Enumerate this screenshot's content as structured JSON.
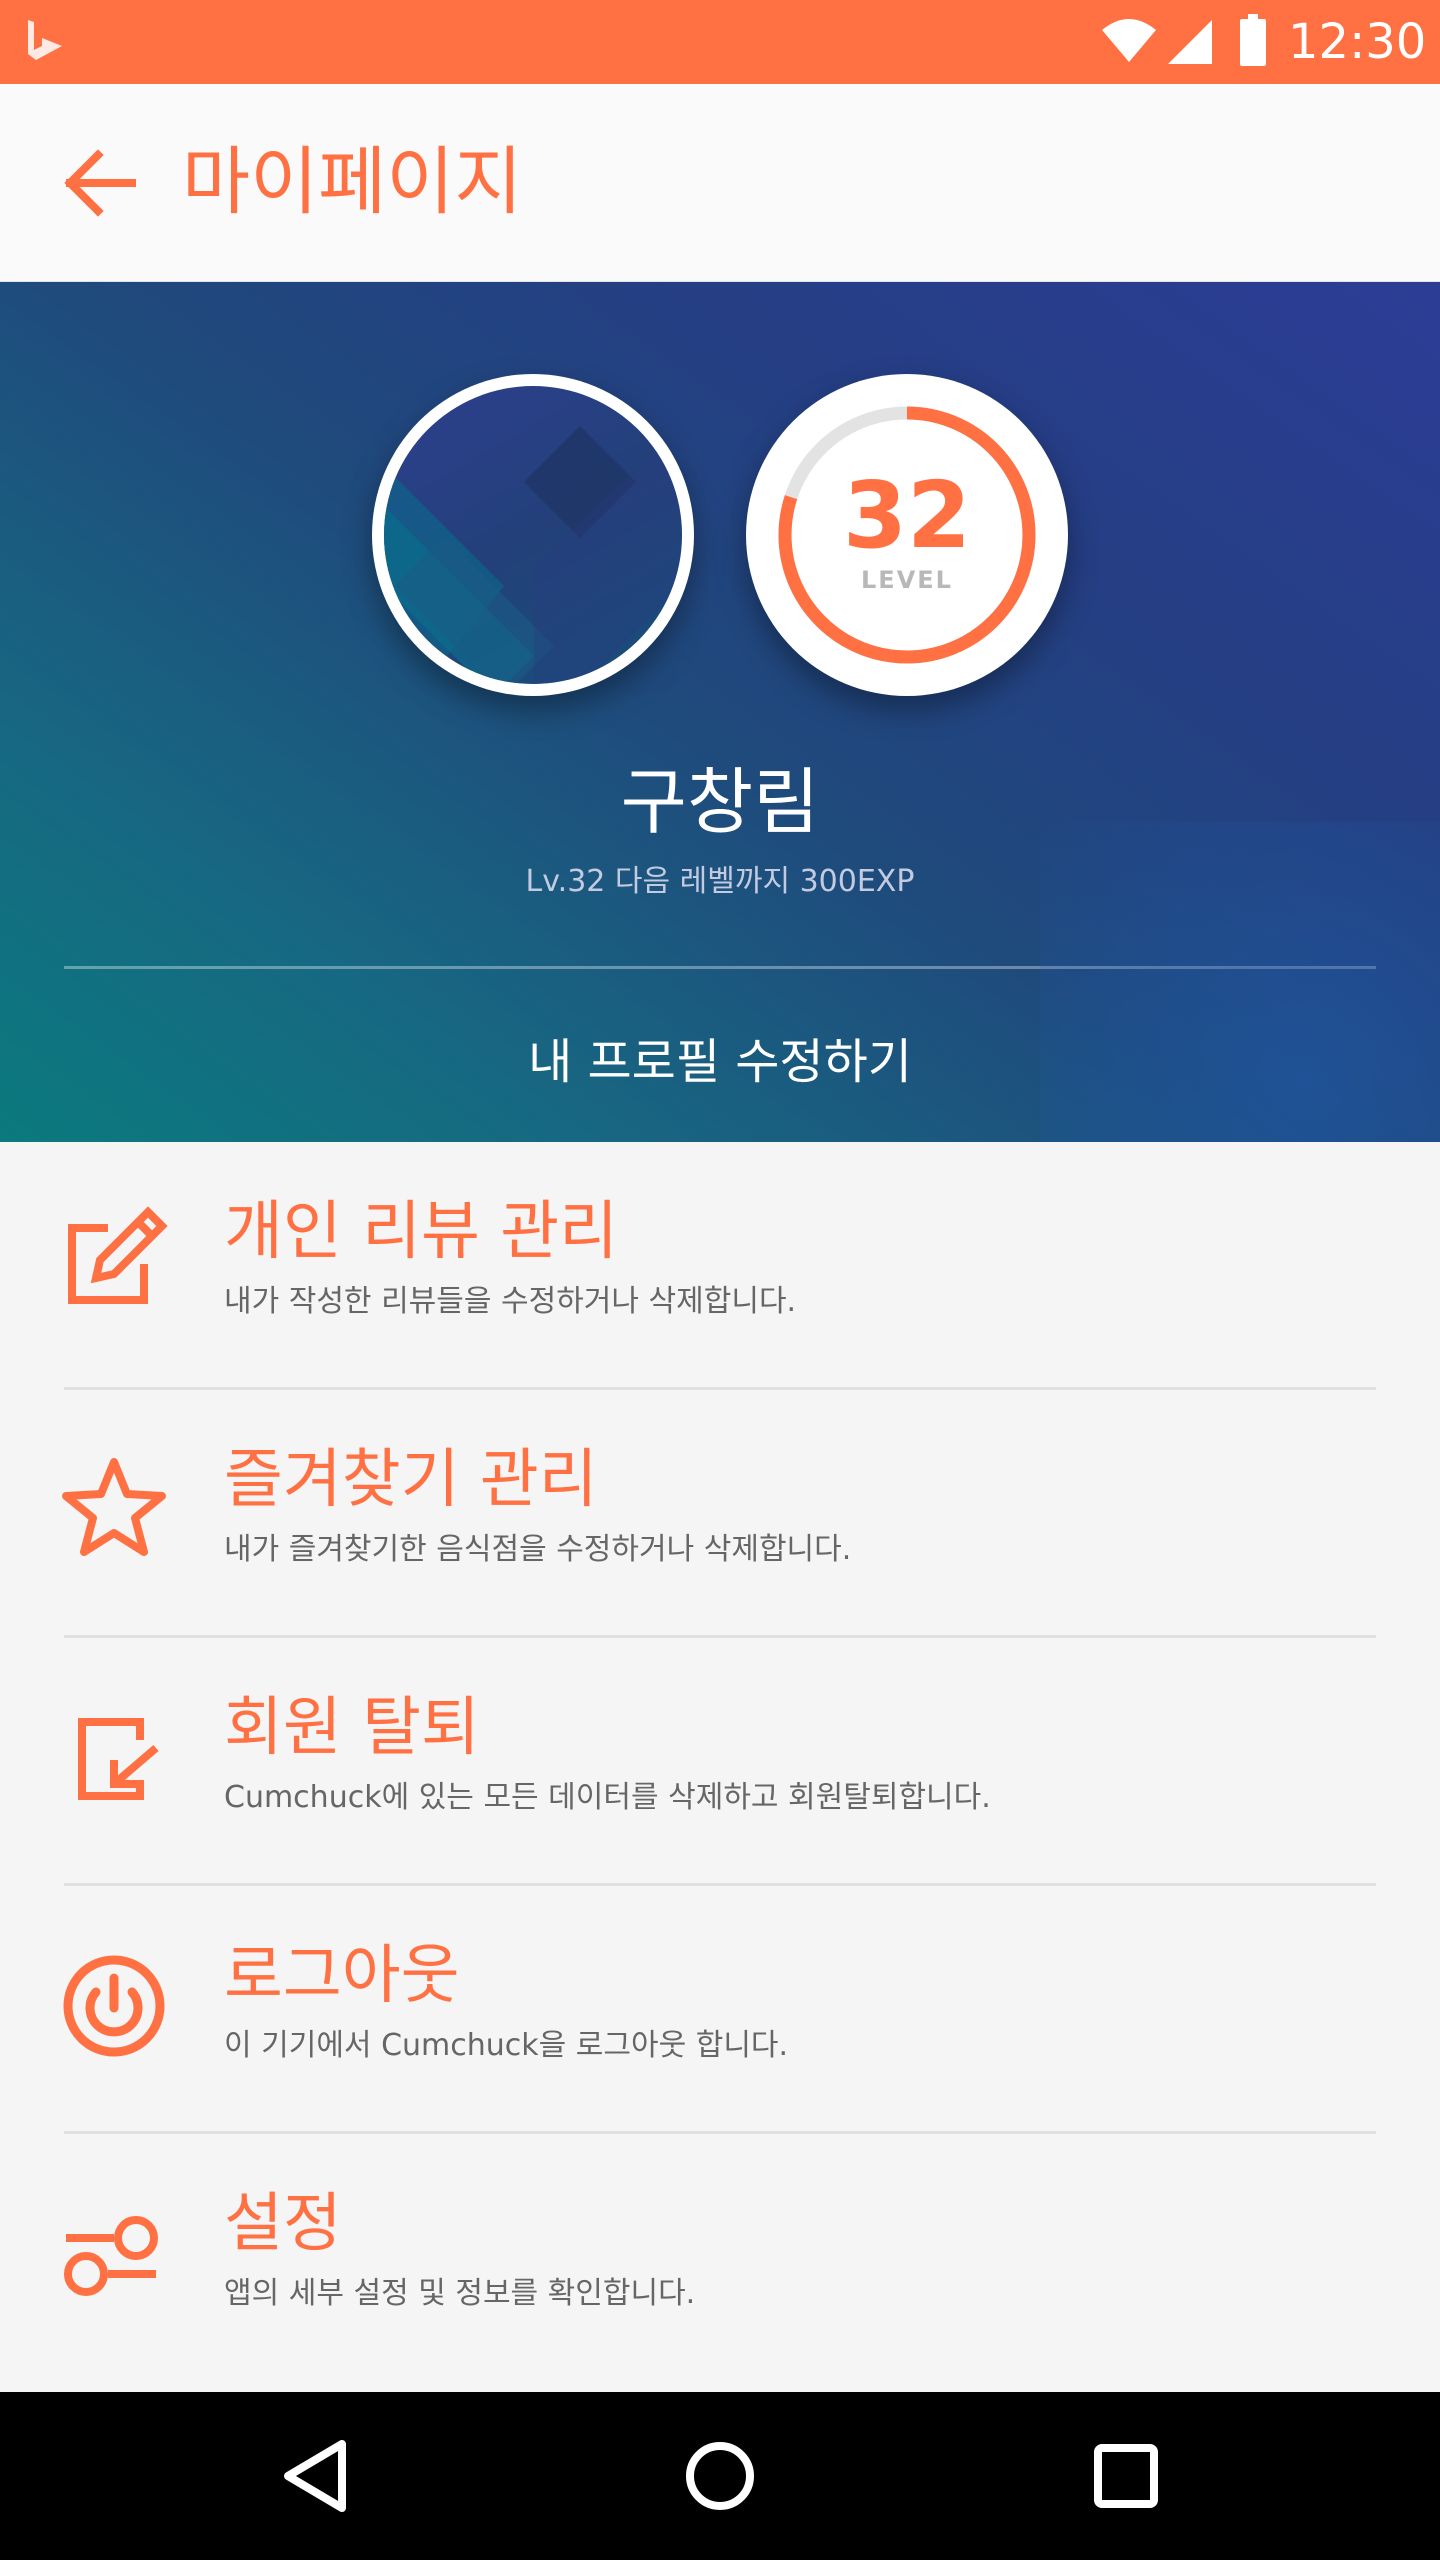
{
  "status_bar": {
    "time": "12:30",
    "icons": [
      "app-logo-icon",
      "wifi-icon",
      "signal-icon",
      "battery-icon"
    ],
    "color": "#ff7043"
  },
  "app_bar": {
    "title": "마이페이지",
    "back_icon": "arrow-back-icon"
  },
  "profile": {
    "name": "구창림",
    "level": "32",
    "level_label": "LEVEL",
    "level_progress": 0.8,
    "subtitle": "Lv.32 다음 레벨까지 300EXP",
    "edit_label": "내 프로필 수정하기"
  },
  "menu": [
    {
      "title": "개인 리뷰 관리",
      "description": "내가 작성한 리뷰들을 수정하거나 삭제합니다.",
      "icon": "edit-icon"
    },
    {
      "title": "즐겨찾기 관리",
      "description": "내가 즐겨찾기한 음식점을 수정하거나 삭제합니다.",
      "icon": "star-icon"
    },
    {
      "title": "회원 탈퇴",
      "description": "Cumchuck에 있는 모든 데이터를 삭제하고 회원탈퇴합니다.",
      "icon": "exit-icon"
    },
    {
      "title": "로그아웃",
      "description": "이 기기에서 Cumchuck을 로그아웃 합니다.",
      "icon": "power-icon"
    },
    {
      "title": "설정",
      "description": "앱의 세부 설정 및 정보를 확인합니다.",
      "icon": "settings-toggle-icon"
    }
  ],
  "nav_bar": {
    "icons": [
      "back-triangle-icon",
      "home-circle-icon",
      "recents-square-icon"
    ]
  },
  "colors": {
    "accent": "#ff7043",
    "hero_gradient": [
      "#0a7a7e",
      "#2c3d96"
    ]
  }
}
